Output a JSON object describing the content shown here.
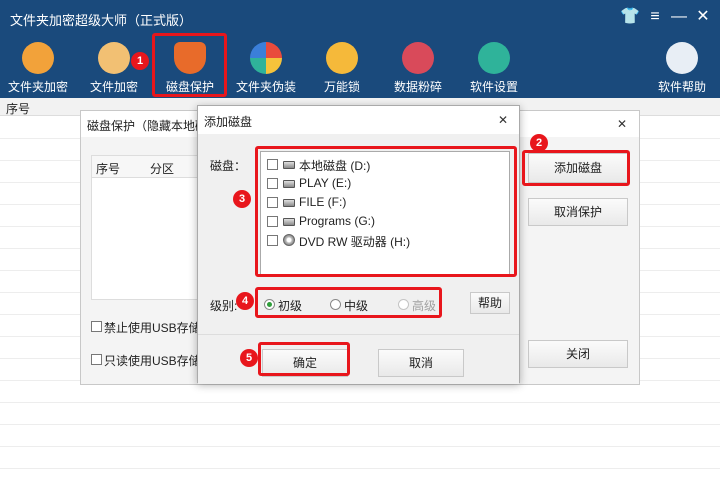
{
  "app": {
    "title": "文件夹加密超级大师（正式版）",
    "controls": {
      "skin": "👕",
      "menu": "≡",
      "minimize": "—",
      "close": "✕"
    }
  },
  "toolbar": {
    "items": [
      {
        "label": "文件夹加密",
        "icon": "folder-lock-icon",
        "color": "#f2a23a"
      },
      {
        "label": "文件加密",
        "icon": "file-lock-icon",
        "color": "#f2a23a"
      },
      {
        "label": "磁盘保护",
        "icon": "shield-icon",
        "color": "#e86b2a"
      },
      {
        "label": "文件夹伪装",
        "icon": "palette-icon",
        "color": "#f2f2f2"
      },
      {
        "label": "万能锁",
        "icon": "padlock-icon",
        "color": "#f5b93a"
      },
      {
        "label": "数据粉碎",
        "icon": "scissors-icon",
        "color": "#d94a5a"
      },
      {
        "label": "软件设置",
        "icon": "gear-icon",
        "color": "#2fb39a"
      }
    ],
    "help_label": "软件帮助"
  },
  "main": {
    "column_header": "序号"
  },
  "disk_protect_window": {
    "title": "磁盘保护（隐藏本地磁",
    "col_index": "序号",
    "col_partition": "分区",
    "add_disk_button": "添加磁盘",
    "cancel_protect_button": "取消保护",
    "close_button": "关闭",
    "usb_disable": "禁止使用USB存储",
    "usb_readonly": "只读使用USB存储"
  },
  "add_disk_dialog": {
    "title": "添加磁盘",
    "disk_label": "磁盘：",
    "disks": [
      {
        "label": "本地磁盘 (D:)",
        "type": "hdd"
      },
      {
        "label": "PLAY (E:)",
        "type": "hdd"
      },
      {
        "label": "FILE (F:)",
        "type": "hdd"
      },
      {
        "label": "Programs (G:)",
        "type": "hdd"
      },
      {
        "label": "DVD RW 驱动器 (H:)",
        "type": "dvd"
      }
    ],
    "level_label": "级别:",
    "levels": [
      {
        "label": "初级",
        "selected": true,
        "enabled": true
      },
      {
        "label": "中级",
        "selected": false,
        "enabled": true
      },
      {
        "label": "高级",
        "selected": false,
        "enabled": false
      }
    ],
    "help_button": "帮助",
    "ok_button": "确定",
    "cancel_button": "取消"
  },
  "annotations": [
    "1",
    "2",
    "3",
    "4",
    "5"
  ],
  "colors": {
    "titlebar": "#1a4a7c",
    "highlight_red": "#e8161c",
    "radio_selected": "#2e9d3a"
  }
}
